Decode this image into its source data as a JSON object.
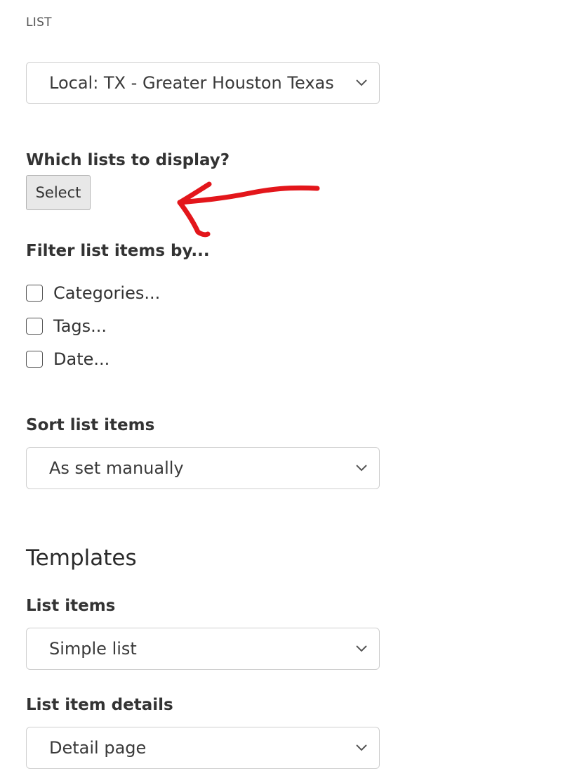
{
  "list_section": {
    "label": "LIST",
    "list_select_value": "Local: TX - Greater Houston Texas"
  },
  "display": {
    "label": "Which lists to display?",
    "select_button_label": "Select"
  },
  "filter": {
    "label": "Filter list items by...",
    "options": [
      {
        "label": "Categories...",
        "checked": false
      },
      {
        "label": "Tags...",
        "checked": false
      },
      {
        "label": "Date...",
        "checked": false
      }
    ]
  },
  "sort": {
    "label": "Sort list items",
    "value": "As set manually"
  },
  "templates": {
    "heading": "Templates",
    "list_items_label": "List items",
    "list_items_value": "Simple list",
    "details_label": "List item details",
    "details_value": "Detail page"
  },
  "colors": {
    "annotation_arrow": "#e3161b",
    "border": "#cfcfcf",
    "button_bg": "#e8e8e8"
  },
  "icons": {
    "select_chevron": "chevron-down-icon",
    "annotation": "red-arrow-annotation"
  }
}
